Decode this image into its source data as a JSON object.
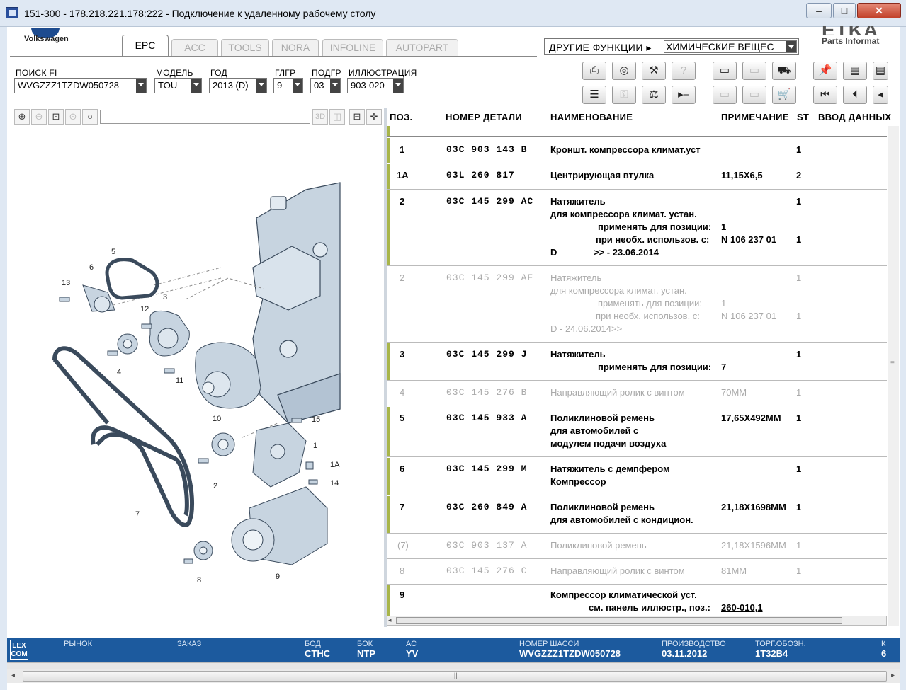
{
  "window": {
    "title": "151-300 - 178.218.221.178:222 - Подключение к удаленному рабочему столу"
  },
  "brand": {
    "vw_label": "Volkswagen",
    "etka_label": "ETKA",
    "etka_sub": "Parts Informat"
  },
  "tabs": [
    "EPC",
    "ACC",
    "TOOLS",
    "NORA",
    "INFOLINE",
    "AUTOPART"
  ],
  "other_functions": {
    "label": "ДРУГИЕ ФУНКЦИИ",
    "value": "ХИМИЧЕСКИЕ ВЕЩЕС"
  },
  "filters": {
    "search_label": "ПОИСК FI",
    "search_value": "WVGZZZ1TZDW050728",
    "model_label": "МОДЕЛЬ",
    "model_value": "TOU",
    "year_label": "ГОД",
    "year_value": "2013 (D)",
    "mgroup_label": "ГЛГР",
    "mgroup_value": "9",
    "subgroup_label": "ПОДГР",
    "subgroup_value": "03",
    "illus_label": "ИЛЛЮСТРАЦИЯ",
    "illus_value": "903-020"
  },
  "table": {
    "headers": {
      "pos": "ПОЗ.",
      "part": "НОМЕР ДЕТАЛИ",
      "name": "НАИМЕНОВАНИЕ",
      "note": "ПРИМЕЧАНИЕ",
      "st": "ST",
      "input": "ВВОД ДАННЫХ"
    },
    "rows": [
      {
        "pos": "1",
        "part": "03C 903 143 B",
        "lines": [
          "Кроншт. компрессора климат.уст"
        ],
        "note": "",
        "st": [
          "1"
        ]
      },
      {
        "pos": "1A",
        "part": "03L 260 817",
        "lines": [
          "Центрирующая втулка"
        ],
        "note": "11,15X6,5",
        "st": [
          "2"
        ]
      },
      {
        "pos": "2",
        "part": "03C 145 299 AC",
        "lines": [
          "Натяжитель",
          "для компрессора климат. устан.",
          "применять для позиции:",
          "при необх. использов. с:",
          "D"
        ],
        "extra": [
          "1",
          "N 106 237 01"
        ],
        "date": ">> - 23.06.2014",
        "st": [
          "1",
          "1"
        ]
      },
      {
        "pos": "2",
        "part": "03C 145 299 AF",
        "lines": [
          "Натяжитель",
          "для компрессора климат. устан.",
          "применять для позиции:",
          "при необх. использов. с:",
          "D - 24.06.2014>>"
        ],
        "extra": [
          "1",
          "N 106 237 01"
        ],
        "st": [
          "1",
          "1"
        ]
      },
      {
        "pos": "3",
        "part": "03C 145 299 J",
        "lines": [
          "Натяжитель",
          "применять для позиции:"
        ],
        "extra": [
          "7"
        ],
        "st": [
          "1"
        ]
      },
      {
        "pos": "4",
        "part": "03C 145 276 B",
        "lines": [
          "Направляющий ролик с винтом"
        ],
        "note": "70MM",
        "st": [
          "1"
        ]
      },
      {
        "pos": "5",
        "part": "03C 145 933 A",
        "lines": [
          "Поликлиновой ремень",
          "для автомобилей с",
          "модулем подачи воздуха"
        ],
        "note": "17,65X492MM",
        "st": [
          "1"
        ]
      },
      {
        "pos": "6",
        "part": "03C 145 299 M",
        "lines": [
          "Натяжитель с демпфером",
          "Компрессор"
        ],
        "note": "",
        "st": [
          "1"
        ]
      },
      {
        "pos": "7",
        "part": "03C 260 849 A",
        "lines": [
          "Поликлиновой ремень",
          "для автомобилей с кондицион."
        ],
        "note": "21,18X1698MM",
        "st": [
          "1"
        ]
      },
      {
        "pos": "(7)",
        "part": "03C 903 137 A",
        "lines": [
          "Поликлиновой ремень"
        ],
        "note": "21,18X1596MM",
        "st": [
          "1"
        ]
      },
      {
        "pos": "8",
        "part": "03C 145 276 C",
        "lines": [
          "Направляющий ролик с винтом"
        ],
        "note": "81MM",
        "st": [
          "1"
        ]
      },
      {
        "pos": "9",
        "part": "",
        "lines": [
          "Компрессор климатической уст.",
          "см. панель иллюстр., поз.:"
        ],
        "link": "260-010,1",
        "note": "",
        "st": []
      }
    ]
  },
  "diagram": {
    "callouts": [
      "5",
      "6",
      "13",
      "3",
      "12",
      "4",
      "11",
      "10",
      "15",
      "1",
      "1A",
      "14",
      "2",
      "7",
      "8",
      "9"
    ]
  },
  "status": {
    "logo": "LEX COM",
    "market_label": "РЫНОК",
    "order_label": "ЗАКАЗ",
    "bod_label": "БОД",
    "bod_value": "CTHC",
    "bok_label": "БОК",
    "bok_value": "NTP",
    "ac_label": "АС",
    "ac_value": "YV",
    "vin_label": "НОМЕР ШАССИ",
    "vin_value": "WVGZZZ1TZDW050728",
    "prod_label": "ПРОИЗВОДСТВО",
    "prod_value": "03.11.2012",
    "trade_label": "ТОРГ.ОБОЗН.",
    "trade_value": "1T32B4",
    "k_label": "К",
    "k_value": "6"
  },
  "icons": {
    "print": "printer-icon",
    "zoom": "magnifier-icon",
    "cart": "cart-icon",
    "pin": "pin-icon"
  },
  "colors": {
    "status_bar": "#1c5a9e",
    "row_marker": "#a8b54a",
    "engine_fill": "#c7d4e0"
  }
}
